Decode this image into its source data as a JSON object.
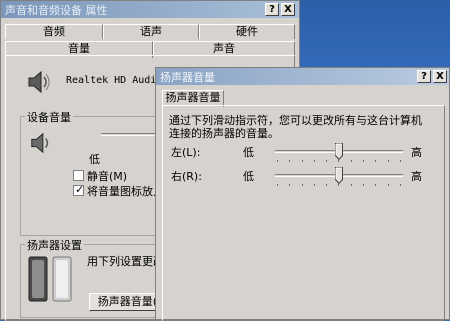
{
  "main_window": {
    "title": "声音和音频设备 属性",
    "help_button": "?",
    "close_button": "X",
    "tabs_back": [
      "音频",
      "语声",
      "硬件"
    ],
    "tabs_front": [
      "音量",
      "声音"
    ],
    "device_name": "Realtek HD Audio ov",
    "device_volume": {
      "legend": "设备音量",
      "low_label": "低",
      "mute_label": "静音(M)",
      "mute_checked": false,
      "taskbar_label": "将音量图标放入任",
      "taskbar_checked": true
    },
    "speaker_settings": {
      "legend": "扬声器设置",
      "description": "用下列设置更改个",
      "speaker_volume_button": "扬声器音量(S)"
    }
  },
  "speaker_dialog": {
    "title": "扬声器音量",
    "help_button": "?",
    "close_button": "X",
    "tab": "扬声器音量",
    "description_line1": "通过下列滑动指示符，您可以更改所有与这台计算机",
    "description_line2": "连接的扬声器的音量。",
    "left": {
      "label": "左(L):",
      "low": "低",
      "high": "高",
      "value_fraction": 0.5
    },
    "right": {
      "label": "右(R):",
      "low": "低",
      "high": "高",
      "value_fraction": 0.5
    }
  },
  "colors": {
    "face": "#d6d3ce",
    "titlebar_inactive": "#7a96b9",
    "desktop": "#3a6ea5"
  }
}
